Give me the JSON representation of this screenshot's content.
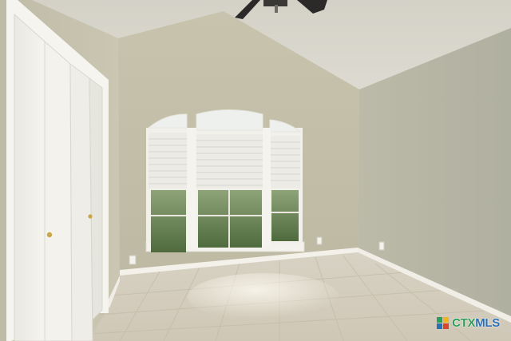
{
  "watermark": {
    "brand_prefix": "CTX",
    "brand_suffix": "MLS",
    "colors": {
      "prefix": "#2e9f5a",
      "suffix": "#2a6fb5"
    }
  },
  "scene": {
    "description_free": true,
    "colors": {
      "ceiling": "#d8d6cb",
      "wall_left": "#c9c6b3",
      "wall_back": "#c2bea9",
      "wall_right": "#b7b6a6",
      "trim": "#f3f1ea",
      "floor": "#d9d3c6",
      "closet_door": "#f2f1ec",
      "fan_blade": "#2b2a28",
      "window_glass": "#6f8a5a",
      "blind": "#ecebe6"
    },
    "icons": [
      "ceiling-fan-icon",
      "closet-knob-icon",
      "electrical-outlet-icon"
    ]
  }
}
